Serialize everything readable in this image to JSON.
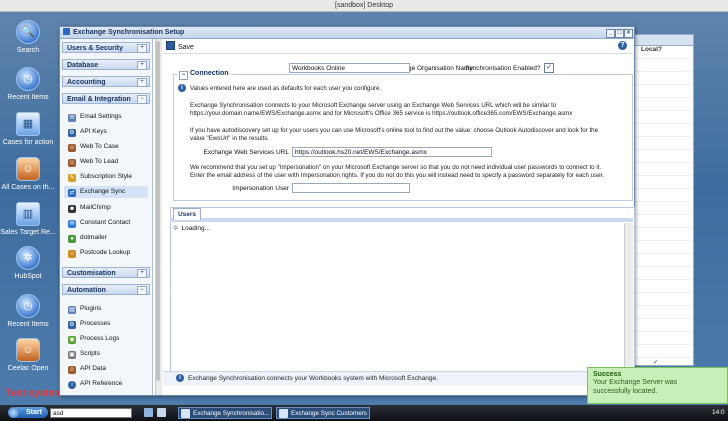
{
  "outer_title": "[sandbox] Desktop",
  "desktop": {
    "icons": [
      {
        "label": "Search",
        "icon": "search-icon",
        "glyph": "🔍"
      },
      {
        "label": "Recent Items",
        "icon": "clock-icon",
        "glyph": "◷"
      },
      {
        "label": "Cases for action",
        "icon": "cases-icon",
        "glyph": "▦"
      },
      {
        "label": "All Cases on th...",
        "icon": "person-icon",
        "glyph": "☺"
      },
      {
        "label": "Sales Target Re...",
        "icon": "chart-icon",
        "glyph": "▥"
      },
      {
        "label": "HubSpot",
        "icon": "hubspot-icon",
        "glyph": "✲"
      },
      {
        "label": "Recent Items",
        "icon": "clock-icon",
        "glyph": "◷"
      },
      {
        "label": "Ceelac Open",
        "icon": "person-icon",
        "glyph": "☺"
      }
    ],
    "test_system": "Test system"
  },
  "bg_window": {
    "header": "Local?",
    "check": "✓"
  },
  "window": {
    "title": "Exchange Synchronisation Setup",
    "sidebar": {
      "sections": [
        {
          "label": "Users & Security",
          "toggle": "+"
        },
        {
          "label": "Database",
          "toggle": "+"
        },
        {
          "label": "Accounting",
          "toggle": "+"
        },
        {
          "label": "Email & Integration",
          "toggle": "−"
        },
        {
          "label": "Customisation",
          "toggle": "+"
        },
        {
          "label": "Automation",
          "toggle": "−"
        }
      ],
      "email_items": [
        {
          "label": "Email Settings",
          "icon": "email-settings-icon",
          "color": "#5c7fb3",
          "glyph": "✉"
        },
        {
          "label": "API Keys",
          "icon": "api-keys-icon",
          "color": "#2d5da3",
          "glyph": "⚙"
        },
        {
          "label": "Web To Case",
          "icon": "web-to-case-icon",
          "color": "#a0592a",
          "glyph": "☺"
        },
        {
          "label": "Web To Lead",
          "icon": "web-to-lead-icon",
          "color": "#a0592a",
          "glyph": "☺"
        },
        {
          "label": "Subscription Style",
          "icon": "subscription-style-icon",
          "color": "#d1a020",
          "glyph": "✎"
        },
        {
          "label": "Exchange Sync",
          "icon": "exchange-sync-icon",
          "color": "#2a6ac3",
          "glyph": "⇄"
        },
        {
          "label": "MailChimp",
          "icon": "mailchimp-icon",
          "color": "#333333",
          "glyph": "☻"
        },
        {
          "label": "Constant Contact",
          "icon": "constant-contact-icon",
          "color": "#2c7bd1",
          "glyph": "✉"
        },
        {
          "label": "dotmailer",
          "icon": "dotmailer-icon",
          "color": "#4a9a3c",
          "glyph": "●"
        },
        {
          "label": "Postcode Lookup",
          "icon": "postcode-lookup-icon",
          "color": "#d18a20",
          "glyph": "⌂"
        }
      ],
      "automation_items": [
        {
          "label": "Plugins",
          "icon": "plugins-icon",
          "color": "#5c7fb3",
          "glyph": "▤"
        },
        {
          "label": "Processes",
          "icon": "processes-icon",
          "color": "#2d5da3",
          "glyph": "⚙"
        },
        {
          "label": "Process Logs",
          "icon": "process-logs-icon",
          "color": "#5aa02c",
          "glyph": "◉"
        },
        {
          "label": "Scripts",
          "icon": "scripts-icon",
          "color": "#777777",
          "glyph": "▣"
        },
        {
          "label": "API Data",
          "icon": "api-data-icon",
          "color": "#a0592a",
          "glyph": "☺"
        },
        {
          "label": "API Reference",
          "icon": "api-reference-icon",
          "color": "#2d5da3",
          "glyph": "i"
        }
      ]
    },
    "toolbar": {
      "save_label": "Save"
    },
    "form": {
      "org_name_label": "Exchange Organisation Name",
      "org_name_value": "Workbooks Online",
      "sync_enabled_label": "Synchronisation Enabled?",
      "sync_check": "✓"
    },
    "connection": {
      "legend": "Connection",
      "intro": "Values entered here are used as defaults for each user you configure.",
      "para1_a": "Exchange Synchronisation connects to your Microsoft Exchange server using an Exchange Web Services URL which will be similar to",
      "para1_b": "https://your.domain.name/EWS/Exchange.asmx and for Microsoft's Office 365 service is https://outlook.office365.com/EWS/Exchange.asmx",
      "para2_a": "If you have autodiscovery set up for your users you can use Microsoft's online tool to find out the value: choose Outlook Autodiscover and look for the",
      "para2_b": "value \"EwsUrl\" in the results.",
      "ews_label": "Exchange Web Services URL",
      "ews_value": "https://outlook.hs20.net/EWS/Exchange.asmx",
      "para3_a": "We recommend that you set up \"Impersonation\" on your Microsoft Exchange server so that you do not need individual user passwords to connect to it.",
      "para3_b": "Enter the email address of the user with Impersonation rights. If you do not do this you will instead need to specify a password separately for each user.",
      "impersonation_label": "Impersonation User",
      "impersonation_value": ""
    },
    "users": {
      "tab_label": "Users",
      "loading": "Loading..."
    },
    "footer": "Exchange Synchronisation connects your Workbooks system with Microsoft Exchange."
  },
  "toast": {
    "title": "Success",
    "message_1": "Your Exchange Server was",
    "message_2": "successfully located."
  },
  "taskbar": {
    "start": "Start",
    "search_value": "asd",
    "tasks": [
      "Exchange Synchronisatio...",
      "Exchange Sync Customers"
    ],
    "clock": "14:0"
  }
}
